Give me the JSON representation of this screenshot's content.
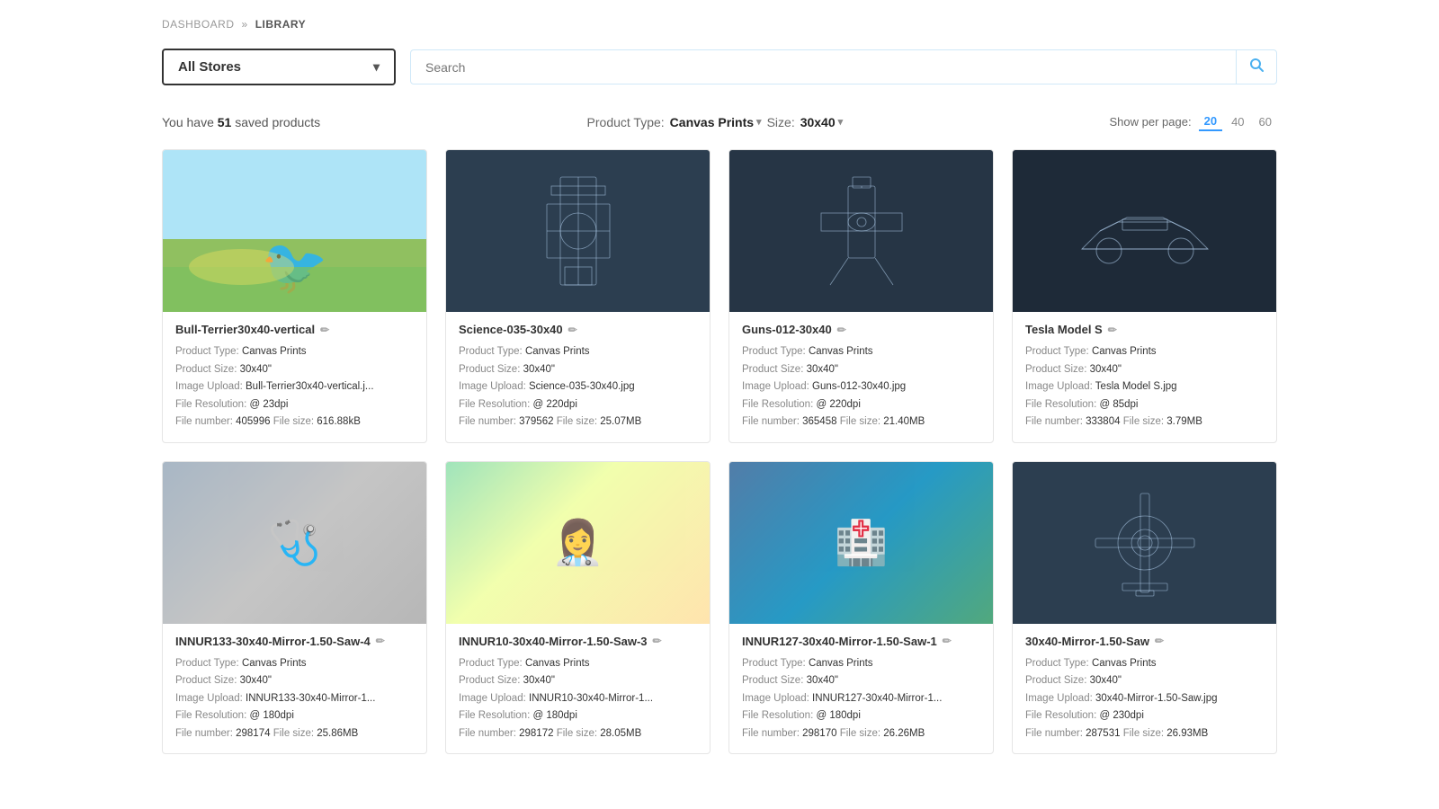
{
  "breadcrumb": {
    "dashboard": "DASHBOARD",
    "separator": "»",
    "current": "LIBRARY"
  },
  "store_selector": {
    "label": "All Stores",
    "placeholder": "All Stores"
  },
  "search": {
    "placeholder": "Search"
  },
  "filters": {
    "saved_count_prefix": "You have ",
    "saved_count": "51",
    "saved_count_suffix": " saved products",
    "product_type_label": "Product Type:",
    "product_type_value": "Canvas Prints",
    "size_label": "Size:",
    "size_value": "30x40",
    "per_page_label": "Show per page:",
    "per_page_options": [
      "20",
      "40",
      "60"
    ],
    "per_page_active": "20"
  },
  "products": [
    {
      "title": "Bull-Terrier30x40-vertical",
      "product_type": "Canvas Prints",
      "product_size": "30x40\"",
      "image_upload": "Bull-Terrier30x40-vertical.j...",
      "file_resolution": "@ 23dpi",
      "file_number": "405996",
      "file_size": "616.88kB",
      "image_type": "bird"
    },
    {
      "title": "Science-035-30x40",
      "product_type": "Canvas Prints",
      "product_size": "30x40\"",
      "image_upload": "Science-035-30x40.jpg",
      "file_resolution": "@ 220dpi",
      "file_number": "379562",
      "file_size": "25.07MB",
      "image_type": "blueprint1"
    },
    {
      "title": "Guns-012-30x40",
      "product_type": "Canvas Prints",
      "product_size": "30x40\"",
      "image_upload": "Guns-012-30x40.jpg",
      "file_resolution": "@ 220dpi",
      "file_number": "365458",
      "file_size": "21.40MB",
      "image_type": "blueprint2"
    },
    {
      "title": "Tesla Model S",
      "product_type": "Canvas Prints",
      "product_size": "30x40\"",
      "image_upload": "Tesla Model S.jpg",
      "file_resolution": "@ 85dpi",
      "file_number": "333804",
      "file_size": "3.79MB",
      "image_type": "car"
    },
    {
      "title": "INNUR133-30x40-Mirror-1.50-Saw-4",
      "product_type": "Canvas Prints",
      "product_size": "30x40\"",
      "image_upload": "INNUR133-30x40-Mirror-1...",
      "file_resolution": "@ 180dpi",
      "file_number": "298174",
      "file_size": "25.86MB",
      "image_type": "medical1"
    },
    {
      "title": "INNUR10-30x40-Mirror-1.50-Saw-3",
      "product_type": "Canvas Prints",
      "product_size": "30x40\"",
      "image_upload": "INNUR10-30x40-Mirror-1...",
      "file_resolution": "@ 180dpi",
      "file_number": "298172",
      "file_size": "28.05MB",
      "image_type": "medical2"
    },
    {
      "title": "INNUR127-30x40-Mirror-1.50-Saw-1",
      "product_type": "Canvas Prints",
      "product_size": "30x40\"",
      "image_upload": "INNUR127-30x40-Mirror-1...",
      "file_resolution": "@ 180dpi",
      "file_number": "298170",
      "file_size": "26.26MB",
      "image_type": "medical3"
    },
    {
      "title": "30x40-Mirror-1.50-Saw",
      "product_type": "Canvas Prints",
      "product_size": "30x40\"",
      "image_upload": "30x40-Mirror-1.50-Saw.jpg",
      "file_resolution": "@ 230dpi",
      "file_number": "287531",
      "file_size": "26.93MB",
      "image_type": "saw"
    }
  ],
  "labels": {
    "product_type": "Product Type:",
    "product_size": "Product Size:",
    "image_upload": "Image Upload:",
    "file_resolution": "File Resolution:",
    "file_number": "File number:",
    "file_size": "File size:"
  }
}
